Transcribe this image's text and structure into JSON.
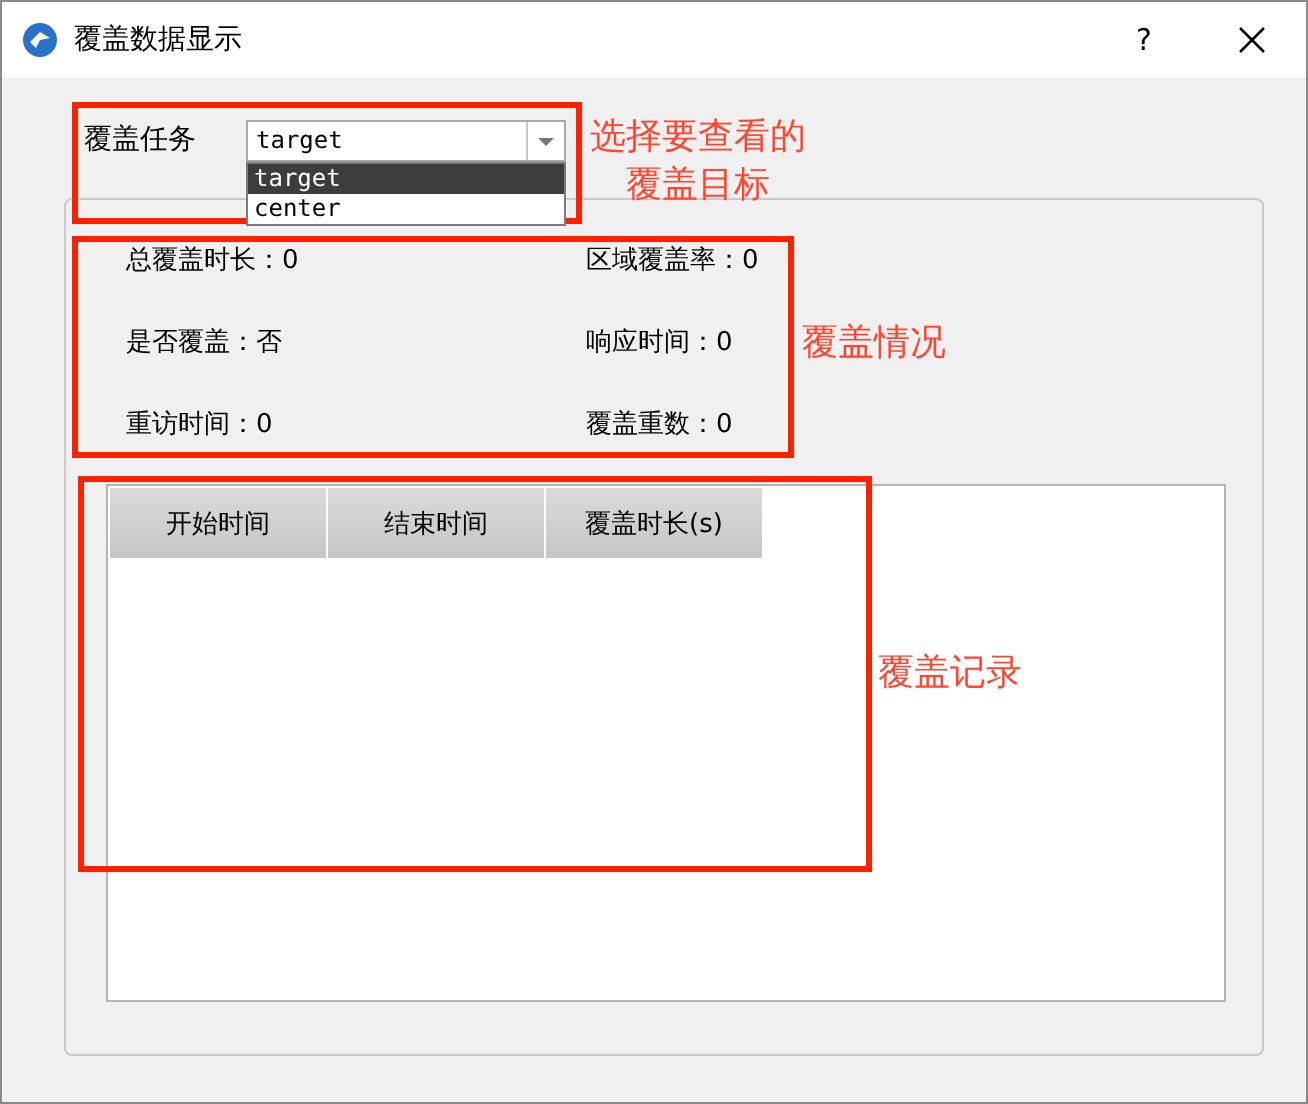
{
  "window": {
    "title": "覆盖数据显示",
    "help": "?"
  },
  "task_selector": {
    "label": "覆盖任务",
    "value": "target",
    "options": [
      {
        "label": "target",
        "selected": true
      },
      {
        "label": "center",
        "selected": false
      }
    ]
  },
  "stats": [
    {
      "text": "总覆盖时长：0"
    },
    {
      "text": "区域覆盖率：0"
    },
    {
      "text": "是否覆盖：否"
    },
    {
      "text": "响应时间：0"
    },
    {
      "text": "重访时间：0"
    },
    {
      "text": "覆盖重数：0"
    }
  ],
  "table": {
    "columns": [
      "开始时间",
      "结束时间",
      "覆盖时长(s)"
    ]
  },
  "annotations": [
    {
      "lines": [
        "选择要查看的",
        "覆盖目标"
      ]
    },
    {
      "lines": [
        "覆盖情况"
      ]
    },
    {
      "lines": [
        "覆盖记录"
      ]
    }
  ]
}
